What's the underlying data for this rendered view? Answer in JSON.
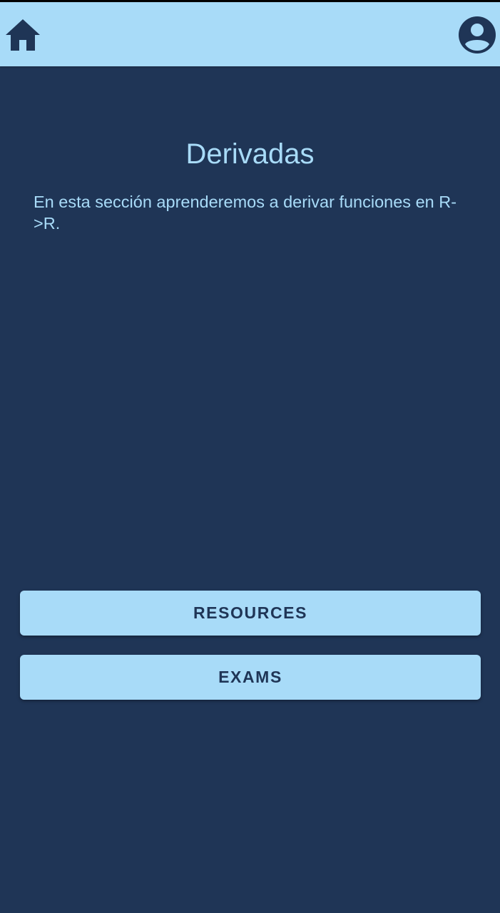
{
  "app_bar": {
    "home_icon": "home-icon",
    "profile_icon": "account-circle-icon"
  },
  "main": {
    "title": "Derivadas",
    "description": "En esta sección aprenderemos a derivar funciones en R->R."
  },
  "actions": {
    "resources_label": "RESOURCES",
    "exams_label": "EXAMS"
  },
  "colors": {
    "background": "#1f3556",
    "accent": "#a8dbf8",
    "status_bar": "#000000"
  }
}
